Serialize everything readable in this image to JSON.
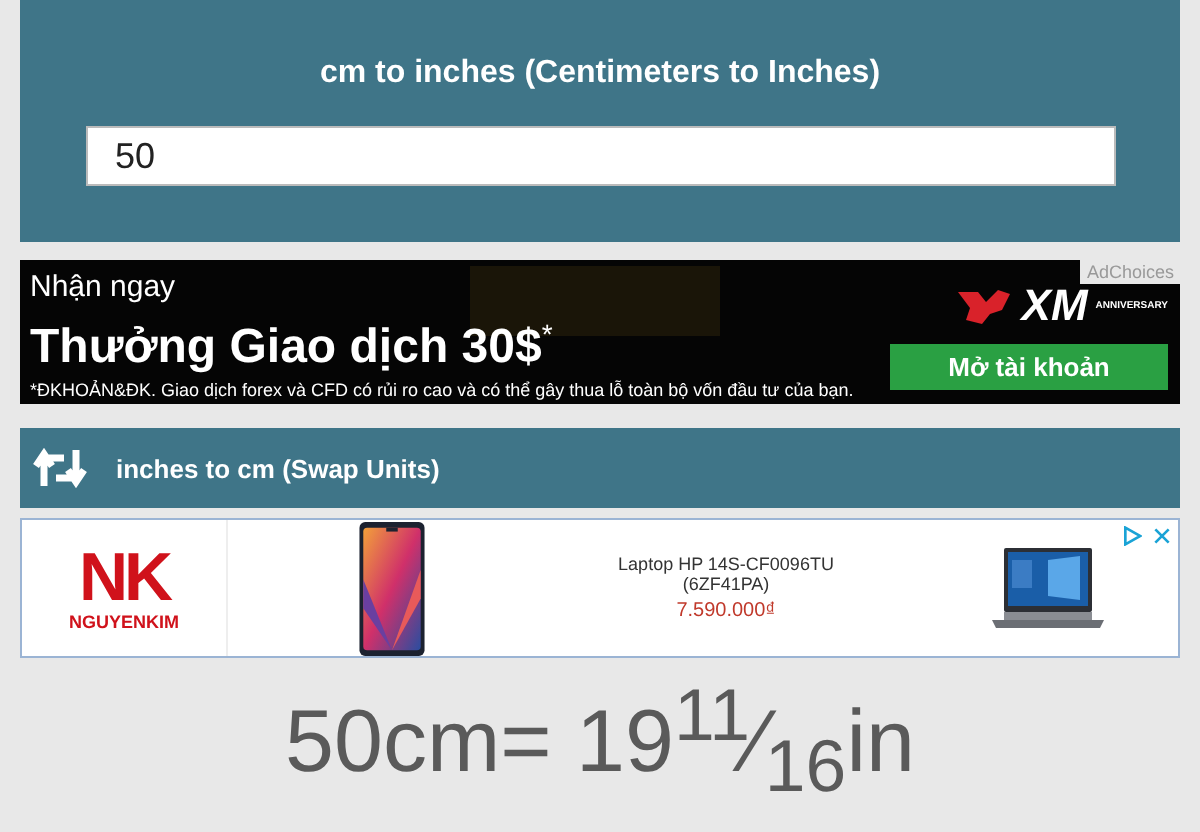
{
  "converter": {
    "title": "cm to inches (Centimeters to Inches)",
    "value": "50"
  },
  "ad_banner": {
    "headline_small": "Nhận ngay",
    "headline": "Thưởng Giao dịch 30$",
    "headline_mark": "*",
    "disclaimer": "*ĐKHOẢN&ĐK. Giao dịch forex và CFD có rủi ro cao và có thể gây thua lỗ toàn bộ vốn đầu tư của bạn.",
    "logo": "XM",
    "anniversary": "ANNIVERSARY",
    "adchoices": "AdChoices",
    "cta": "Mở tài khoản"
  },
  "swap": {
    "label": "inches to cm (Swap Units)"
  },
  "product_ad": {
    "logo": "NK",
    "brand": "NGUYENKIM",
    "product": "Laptop HP 14S-CF0096TU (6ZF41PA)",
    "price": "7.590.000₫"
  },
  "result": "50cm= 19$^{11}$⁄$_{16}$in"
}
